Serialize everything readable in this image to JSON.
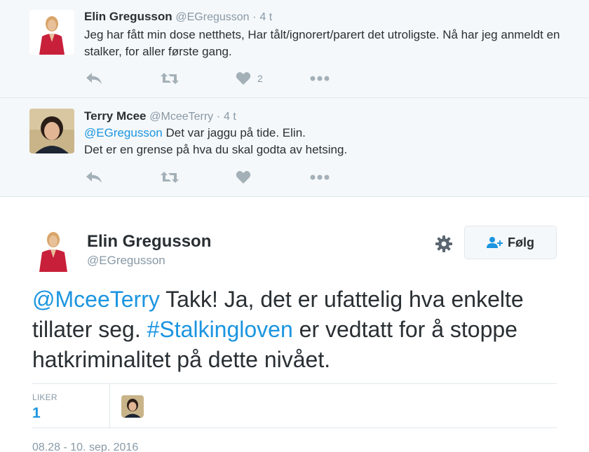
{
  "tweets": [
    {
      "name": "Elin Gregusson",
      "handle": "@EGregusson",
      "dot": "·",
      "time": "4 t",
      "text": "Jeg har fått min dose netthets, Har tålt/ignorert/parert det utroligste. Nå har jeg anmeldt en stalker, for aller første gang.",
      "like_count": "2"
    },
    {
      "name": "Terry Mcee",
      "handle": "@MceeTerry",
      "dot": "·",
      "time": "4 t",
      "mention": "@EGregusson",
      "text_line1": " Det var jaggu på tide. Elin.",
      "text_line2": "Det er en grense på hva du skal godta av hetsing."
    }
  ],
  "main_tweet": {
    "name": "Elin Gregusson",
    "handle": "@EGregusson",
    "follow_label": "Følg",
    "mention": "@MceeTerry",
    "text_part1": " Takk! Ja, det er ufattelig hva enkelte tillater seg. ",
    "hashtag": "#Stalkingloven",
    "text_part2": " er vedtatt for å stoppe hatkriminalitet på dette nivået.",
    "likes_label": "LIKER",
    "likes_count": "1",
    "timestamp": "08.28 - 10. sep. 2016"
  },
  "colors": {
    "link": "#1b95e0",
    "text": "#292f33",
    "muted": "#8899a6",
    "icon": "#a4b0b8",
    "reply_bg": "#f5f8fa"
  },
  "icons": [
    "reply-icon",
    "retweet-icon",
    "heart-icon",
    "more-icon",
    "gear-icon",
    "follow-user-icon"
  ]
}
